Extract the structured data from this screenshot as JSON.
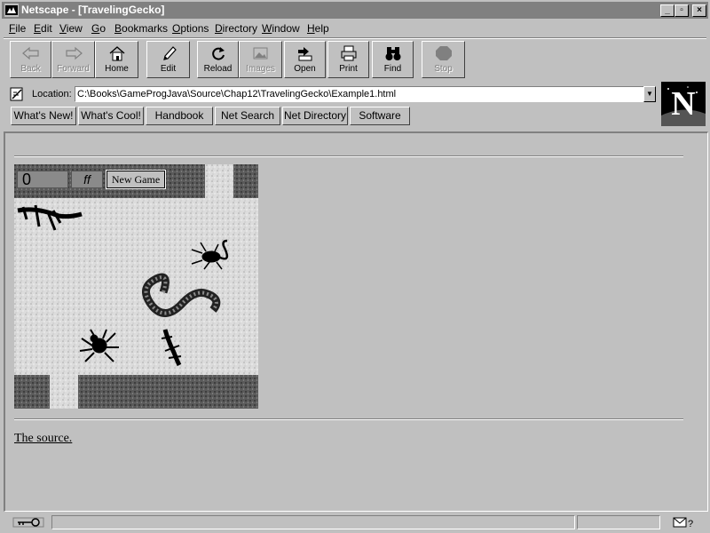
{
  "window": {
    "title": "Netscape - [TravelingGecko]"
  },
  "menu": [
    {
      "label": "File",
      "ul": "F",
      "rest": "ile"
    },
    {
      "label": "Edit",
      "ul": "E",
      "rest": "dit"
    },
    {
      "label": "View",
      "ul": "V",
      "rest": "iew"
    },
    {
      "label": "Go",
      "ul": "G",
      "rest": "o"
    },
    {
      "label": "Bookmarks",
      "ul": "B",
      "rest": "ookmarks"
    },
    {
      "label": "Options",
      "ul": "O",
      "rest": "ptions"
    },
    {
      "label": "Directory",
      "ul": "D",
      "rest": "irectory"
    },
    {
      "label": "Window",
      "ul": "W",
      "rest": "indow"
    },
    {
      "label": "Help",
      "ul": "H",
      "rest": "elp"
    }
  ],
  "toolbar": {
    "back": "Back",
    "forward": "Forward",
    "home": "Home",
    "edit": "Edit",
    "reload": "Reload",
    "images": "Images",
    "open": "Open",
    "print": "Print",
    "find": "Find",
    "stop": "Stop"
  },
  "location": {
    "label": "Location:",
    "url": "C:\\Books\\GameProgJava\\Source\\Chap12\\TravelingGecko\\Example1.html"
  },
  "directory_buttons": [
    "What's New!",
    "What's Cool!",
    "Handbook",
    "Net Search",
    "Net Directory",
    "Software"
  ],
  "logo": {
    "letter": "N"
  },
  "game": {
    "score": "0",
    "lives": "ff",
    "new_game": "New Game"
  },
  "content": {
    "source_link": "The source."
  },
  "colors": {
    "chrome": "#c0c0c0",
    "titlebar": "#808080",
    "logo_bg": "#000000"
  }
}
